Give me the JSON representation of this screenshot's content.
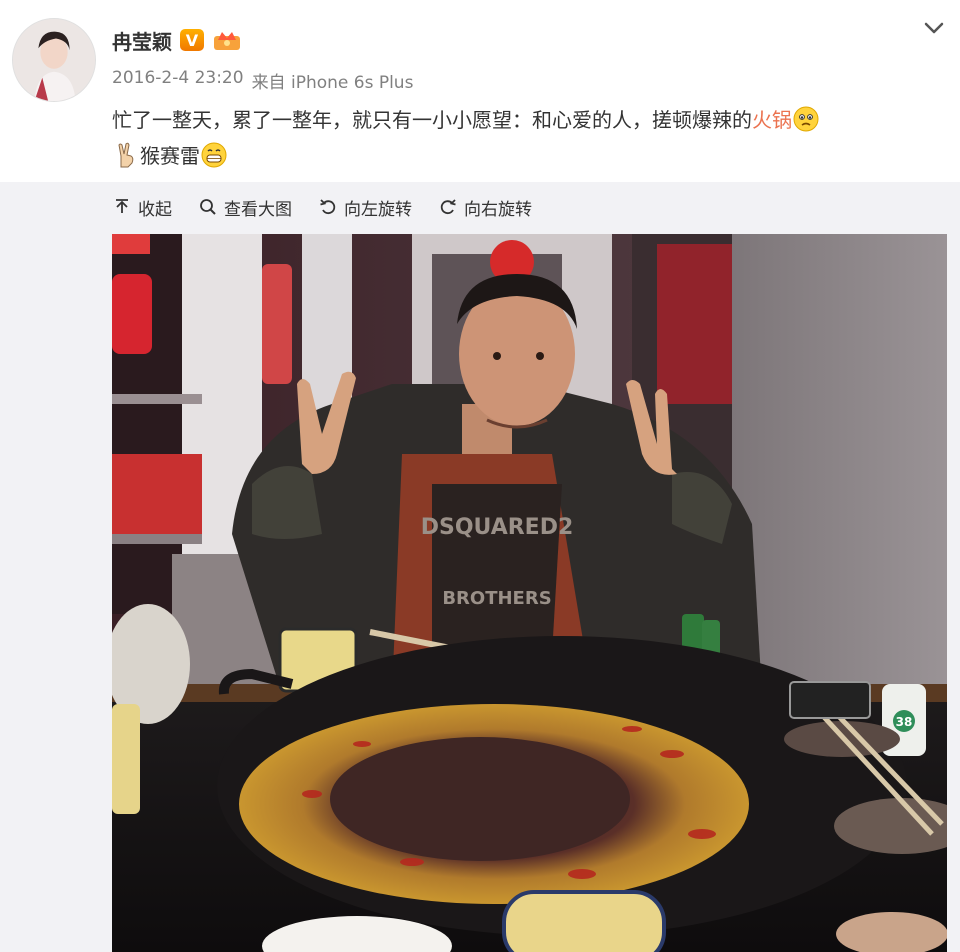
{
  "user": {
    "name": "冉莹颖",
    "verified_badge": "V",
    "crown_icon": "crown-icon"
  },
  "meta": {
    "timestamp": "2016-2-4 23:20",
    "source": "来自 iPhone 6s Plus"
  },
  "post": {
    "text_part1": "忙了一整天，累了一整年，就只有一小小愿望：和心爱的人，搓顿爆辣的",
    "text_highlight": "火锅",
    "text_part2": "猴赛雷",
    "emoji_1": "sad-face-emoji",
    "emoji_2": "peace-sign-emoji",
    "emoji_3": "grin-emoji"
  },
  "toolbar": {
    "collapse_label": "收起",
    "view_large_label": "查看大图",
    "rotate_left_label": "向左旋转",
    "rotate_right_label": "向右旋转"
  },
  "photo": {
    "shirt_text_1": "DSQUARED2",
    "shirt_text_2": "BROTHERS",
    "cup_number": "38"
  },
  "colors": {
    "highlight": "#eb7350",
    "meta_gray": "#808080",
    "badge_orange": "#f59000",
    "panel_bg": "#f2f2f5"
  }
}
